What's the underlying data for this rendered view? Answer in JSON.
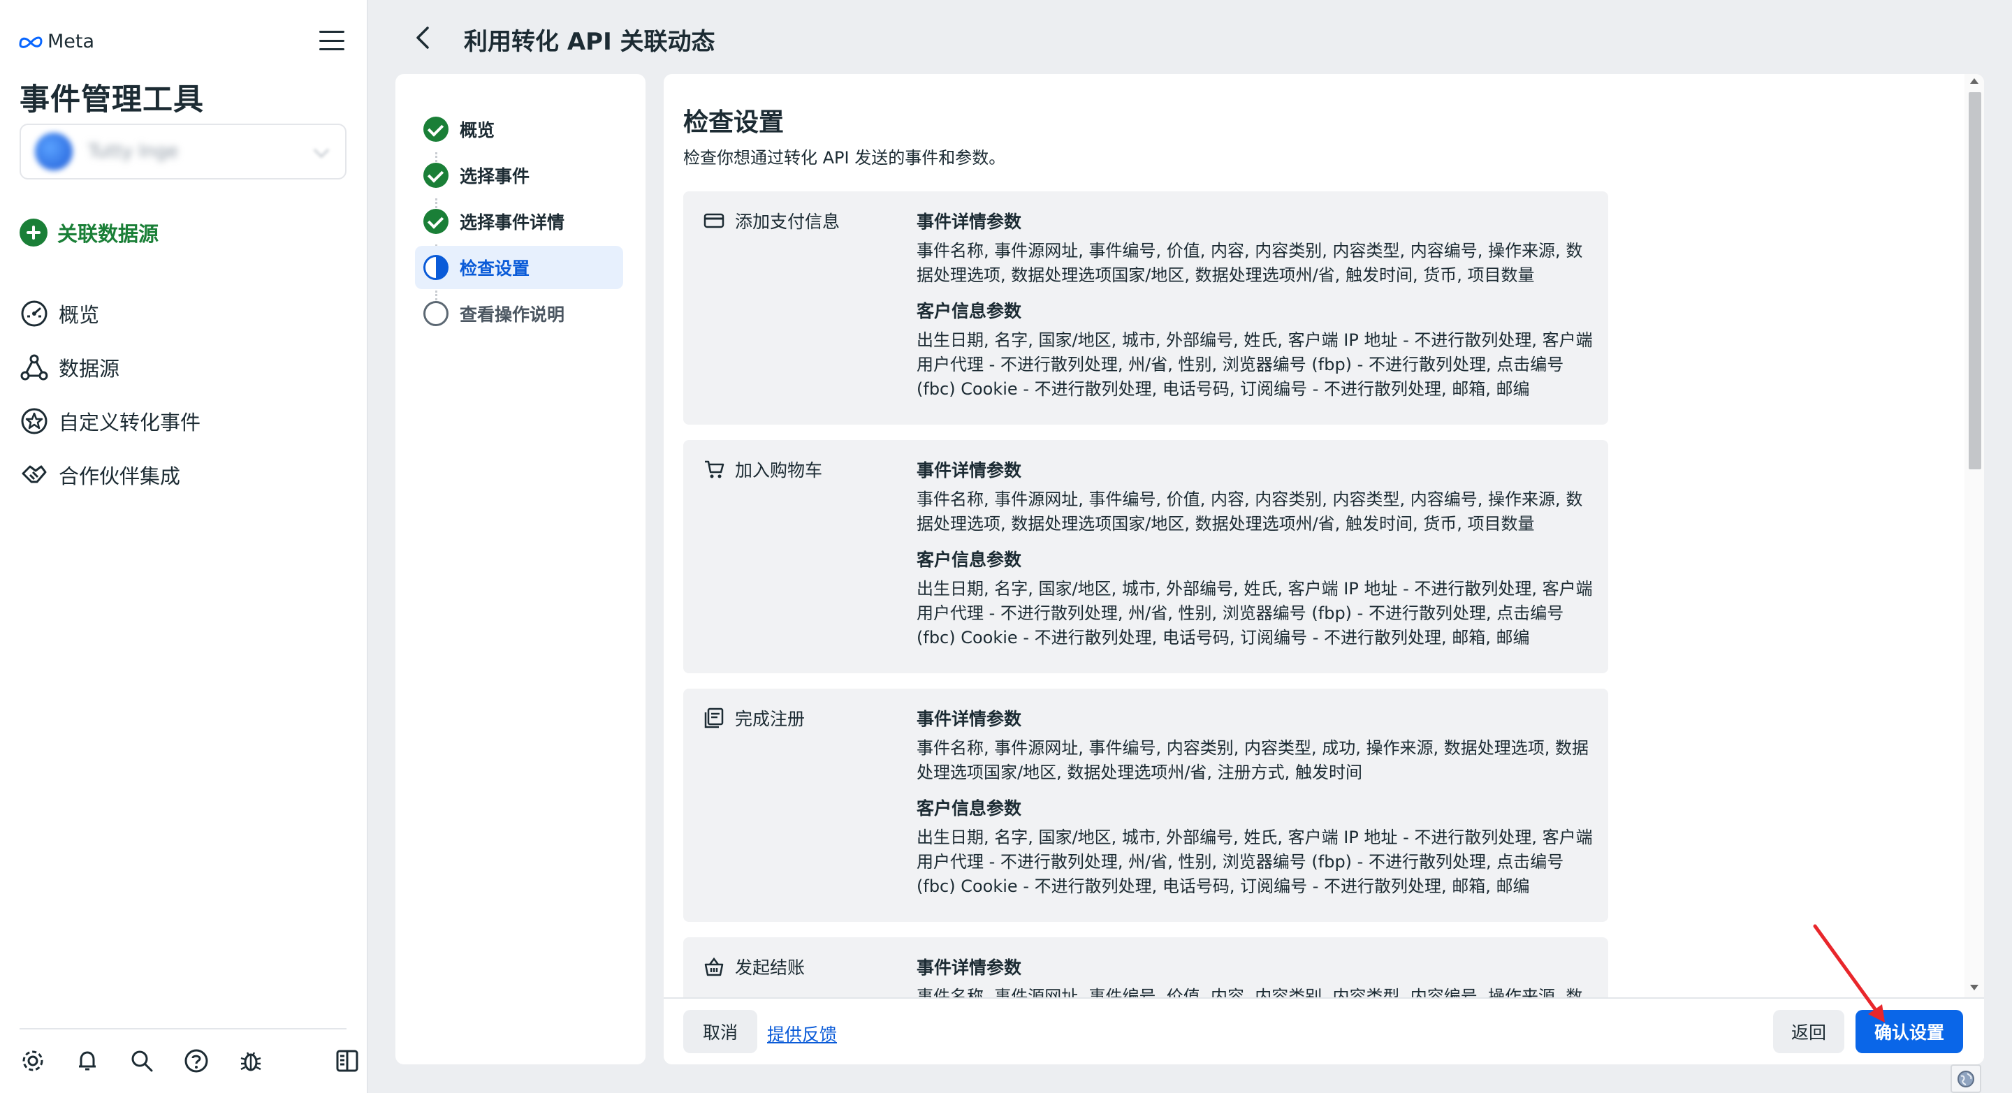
{
  "brand": {
    "logo_text": "Meta"
  },
  "sidebar": {
    "app_title": "事件管理工具",
    "account_name": "Tutty Inge",
    "connect_label": "关联数据源",
    "nav": [
      {
        "label": "概览",
        "icon": "gauge-icon"
      },
      {
        "label": "数据源",
        "icon": "nodes-icon"
      },
      {
        "label": "自定义转化事件",
        "icon": "star-badge-icon"
      },
      {
        "label": "合作伙伴集成",
        "icon": "handshake-icon"
      }
    ],
    "footer_icons": [
      "gear-icon",
      "bell-icon",
      "search-icon",
      "help-icon",
      "bug-icon",
      "panel-toggle-icon"
    ]
  },
  "header": {
    "title": "利用转化 API 关联动态"
  },
  "steps": [
    {
      "label": "概览",
      "state": "done"
    },
    {
      "label": "选择事件",
      "state": "done"
    },
    {
      "label": "选择事件详情",
      "state": "done"
    },
    {
      "label": "检查设置",
      "state": "current"
    },
    {
      "label": "查看操作说明",
      "state": "todo"
    }
  ],
  "review": {
    "title": "检查设置",
    "description": "检查你想通过转化 API 发送的事件和参数。",
    "events": [
      {
        "name": "添加支付信息",
        "icon": "credit-card-icon",
        "event_params_title": "事件详情参数",
        "event_params": "事件名称, 事件源网址, 事件编号, 价值, 内容, 内容类别, 内容类型, 内容编号, 操作来源, 数据处理选项, 数据处理选项国家/地区, 数据处理选项州/省, 触发时间, 货币, 项目数量",
        "customer_params_title": "客户信息参数",
        "customer_params": "出生日期, 名字, 国家/地区, 城市, 外部编号, 姓氏, 客户端 IP 地址 - 不进行散列处理, 客户端用户代理 - 不进行散列处理, 州/省, 性别, 浏览器编号 (fbp) - 不进行散列处理, 点击编号 (fbc) Cookie - 不进行散列处理, 电话号码, 订阅编号 - 不进行散列处理, 邮箱, 邮编"
      },
      {
        "name": "加入购物车",
        "icon": "cart-icon",
        "event_params_title": "事件详情参数",
        "event_params": "事件名称, 事件源网址, 事件编号, 价值, 内容, 内容类别, 内容类型, 内容编号, 操作来源, 数据处理选项, 数据处理选项国家/地区, 数据处理选项州/省, 触发时间, 货币, 项目数量",
        "customer_params_title": "客户信息参数",
        "customer_params": "出生日期, 名字, 国家/地区, 城市, 外部编号, 姓氏, 客户端 IP 地址 - 不进行散列处理, 客户端用户代理 - 不进行散列处理, 州/省, 性别, 浏览器编号 (fbp) - 不进行散列处理, 点击编号 (fbc) Cookie - 不进行散列处理, 电话号码, 订阅编号 - 不进行散列处理, 邮箱, 邮编"
      },
      {
        "name": "完成注册",
        "icon": "registration-icon",
        "event_params_title": "事件详情参数",
        "event_params": "事件名称, 事件源网址, 事件编号, 内容类别, 内容类型, 成功, 操作来源, 数据处理选项, 数据处理选项国家/地区, 数据处理选项州/省, 注册方式, 触发时间",
        "customer_params_title": "客户信息参数",
        "customer_params": "出生日期, 名字, 国家/地区, 城市, 外部编号, 姓氏, 客户端 IP 地址 - 不进行散列处理, 客户端用户代理 - 不进行散列处理, 州/省, 性别, 浏览器编号 (fbp) - 不进行散列处理, 点击编号 (fbc) Cookie - 不进行散列处理, 电话号码, 订阅编号 - 不进行散列处理, 邮箱, 邮编"
      },
      {
        "name": "发起结账",
        "icon": "basket-icon",
        "event_params_title": "事件详情参数",
        "event_params": "事件名称, 事件源网址, 事件编号, 价值, 内容, 内容类别, 内容类型, 内容编号, 操作来源, 数"
      }
    ]
  },
  "footer": {
    "cancel": "取消",
    "feedback": "提供反馈",
    "back": "返回",
    "confirm": "确认设置"
  },
  "colors": {
    "accent": "#0a66e8",
    "success": "#1a7f37",
    "annotation": "#e8262b"
  }
}
